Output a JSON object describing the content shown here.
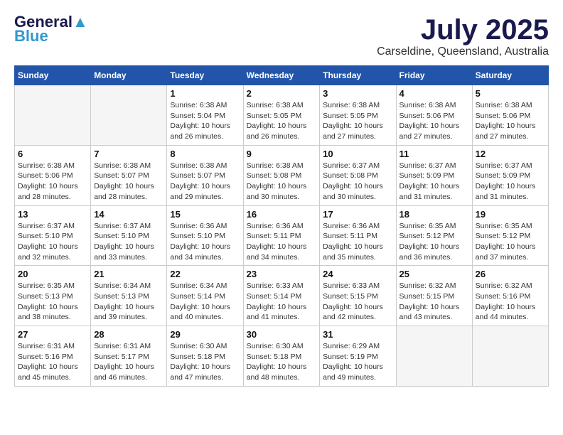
{
  "header": {
    "logo_general": "General",
    "logo_blue": "Blue",
    "month_title": "July 2025",
    "location": "Carseldine, Queensland, Australia"
  },
  "days_of_week": [
    "Sunday",
    "Monday",
    "Tuesday",
    "Wednesday",
    "Thursday",
    "Friday",
    "Saturday"
  ],
  "weeks": [
    [
      {
        "day": "",
        "empty": true
      },
      {
        "day": "",
        "empty": true
      },
      {
        "day": "1",
        "sunrise": "6:38 AM",
        "sunset": "5:04 PM",
        "daylight": "10 hours and 26 minutes."
      },
      {
        "day": "2",
        "sunrise": "6:38 AM",
        "sunset": "5:05 PM",
        "daylight": "10 hours and 26 minutes."
      },
      {
        "day": "3",
        "sunrise": "6:38 AM",
        "sunset": "5:05 PM",
        "daylight": "10 hours and 27 minutes."
      },
      {
        "day": "4",
        "sunrise": "6:38 AM",
        "sunset": "5:06 PM",
        "daylight": "10 hours and 27 minutes."
      },
      {
        "day": "5",
        "sunrise": "6:38 AM",
        "sunset": "5:06 PM",
        "daylight": "10 hours and 27 minutes."
      }
    ],
    [
      {
        "day": "6",
        "sunrise": "6:38 AM",
        "sunset": "5:06 PM",
        "daylight": "10 hours and 28 minutes."
      },
      {
        "day": "7",
        "sunrise": "6:38 AM",
        "sunset": "5:07 PM",
        "daylight": "10 hours and 28 minutes."
      },
      {
        "day": "8",
        "sunrise": "6:38 AM",
        "sunset": "5:07 PM",
        "daylight": "10 hours and 29 minutes."
      },
      {
        "day": "9",
        "sunrise": "6:38 AM",
        "sunset": "5:08 PM",
        "daylight": "10 hours and 30 minutes."
      },
      {
        "day": "10",
        "sunrise": "6:37 AM",
        "sunset": "5:08 PM",
        "daylight": "10 hours and 30 minutes."
      },
      {
        "day": "11",
        "sunrise": "6:37 AM",
        "sunset": "5:09 PM",
        "daylight": "10 hours and 31 minutes."
      },
      {
        "day": "12",
        "sunrise": "6:37 AM",
        "sunset": "5:09 PM",
        "daylight": "10 hours and 31 minutes."
      }
    ],
    [
      {
        "day": "13",
        "sunrise": "6:37 AM",
        "sunset": "5:10 PM",
        "daylight": "10 hours and 32 minutes."
      },
      {
        "day": "14",
        "sunrise": "6:37 AM",
        "sunset": "5:10 PM",
        "daylight": "10 hours and 33 minutes."
      },
      {
        "day": "15",
        "sunrise": "6:36 AM",
        "sunset": "5:10 PM",
        "daylight": "10 hours and 34 minutes."
      },
      {
        "day": "16",
        "sunrise": "6:36 AM",
        "sunset": "5:11 PM",
        "daylight": "10 hours and 34 minutes."
      },
      {
        "day": "17",
        "sunrise": "6:36 AM",
        "sunset": "5:11 PM",
        "daylight": "10 hours and 35 minutes."
      },
      {
        "day": "18",
        "sunrise": "6:35 AM",
        "sunset": "5:12 PM",
        "daylight": "10 hours and 36 minutes."
      },
      {
        "day": "19",
        "sunrise": "6:35 AM",
        "sunset": "5:12 PM",
        "daylight": "10 hours and 37 minutes."
      }
    ],
    [
      {
        "day": "20",
        "sunrise": "6:35 AM",
        "sunset": "5:13 PM",
        "daylight": "10 hours and 38 minutes."
      },
      {
        "day": "21",
        "sunrise": "6:34 AM",
        "sunset": "5:13 PM",
        "daylight": "10 hours and 39 minutes."
      },
      {
        "day": "22",
        "sunrise": "6:34 AM",
        "sunset": "5:14 PM",
        "daylight": "10 hours and 40 minutes."
      },
      {
        "day": "23",
        "sunrise": "6:33 AM",
        "sunset": "5:14 PM",
        "daylight": "10 hours and 41 minutes."
      },
      {
        "day": "24",
        "sunrise": "6:33 AM",
        "sunset": "5:15 PM",
        "daylight": "10 hours and 42 minutes."
      },
      {
        "day": "25",
        "sunrise": "6:32 AM",
        "sunset": "5:15 PM",
        "daylight": "10 hours and 43 minutes."
      },
      {
        "day": "26",
        "sunrise": "6:32 AM",
        "sunset": "5:16 PM",
        "daylight": "10 hours and 44 minutes."
      }
    ],
    [
      {
        "day": "27",
        "sunrise": "6:31 AM",
        "sunset": "5:16 PM",
        "daylight": "10 hours and 45 minutes."
      },
      {
        "day": "28",
        "sunrise": "6:31 AM",
        "sunset": "5:17 PM",
        "daylight": "10 hours and 46 minutes."
      },
      {
        "day": "29",
        "sunrise": "6:30 AM",
        "sunset": "5:18 PM",
        "daylight": "10 hours and 47 minutes."
      },
      {
        "day": "30",
        "sunrise": "6:30 AM",
        "sunset": "5:18 PM",
        "daylight": "10 hours and 48 minutes."
      },
      {
        "day": "31",
        "sunrise": "6:29 AM",
        "sunset": "5:19 PM",
        "daylight": "10 hours and 49 minutes."
      },
      {
        "day": "",
        "empty": true
      },
      {
        "day": "",
        "empty": true
      }
    ]
  ]
}
